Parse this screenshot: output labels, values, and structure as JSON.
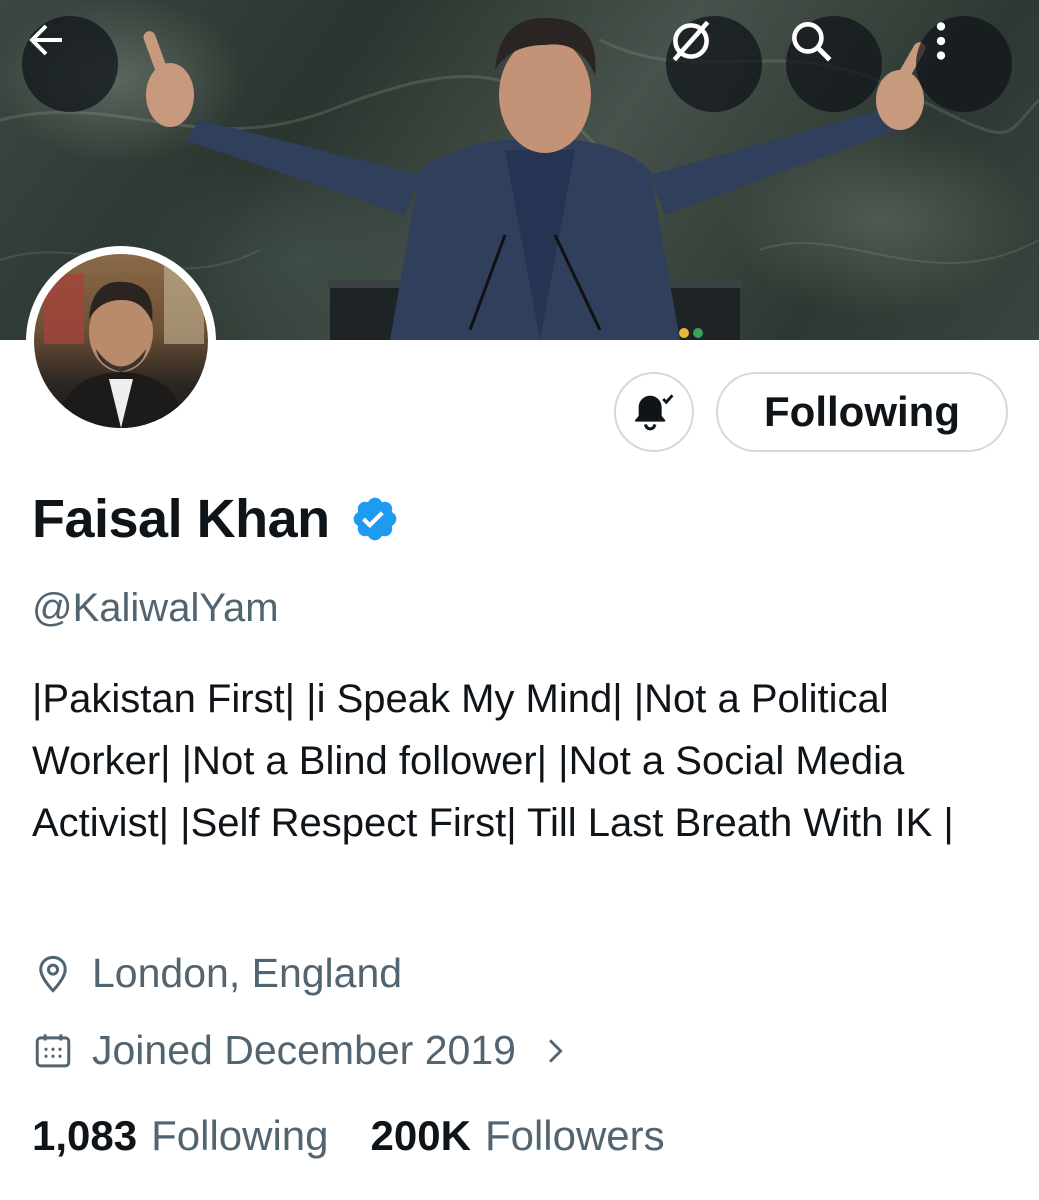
{
  "header": {
    "back_icon": "arrow-left-icon",
    "grok_icon": "grok-icon",
    "search_icon": "search-icon",
    "more_icon": "more-vertical-icon"
  },
  "profile": {
    "display_name": "Faisal Khan",
    "handle": "@KaliwalYam",
    "verified": true,
    "bio": "|Pakistan First| |i Speak My Mind| |Not a Political Worker| |Not a Blind follower| |Not a Social Media Activist| |Self Respect First| Till Last Breath With IK |",
    "location": "London, England",
    "joined": "Joined December 2019"
  },
  "actions": {
    "notify_icon": "bell-subscribed-icon",
    "follow_label": "Following"
  },
  "stats": {
    "following_count": "1,083",
    "following_label": "Following",
    "followers_count": "200K",
    "followers_label": "Followers"
  },
  "colors": {
    "verified_blue": "#1d9bf0",
    "text_primary": "#0f1419",
    "text_secondary": "#536471",
    "border": "#cfd9de"
  }
}
